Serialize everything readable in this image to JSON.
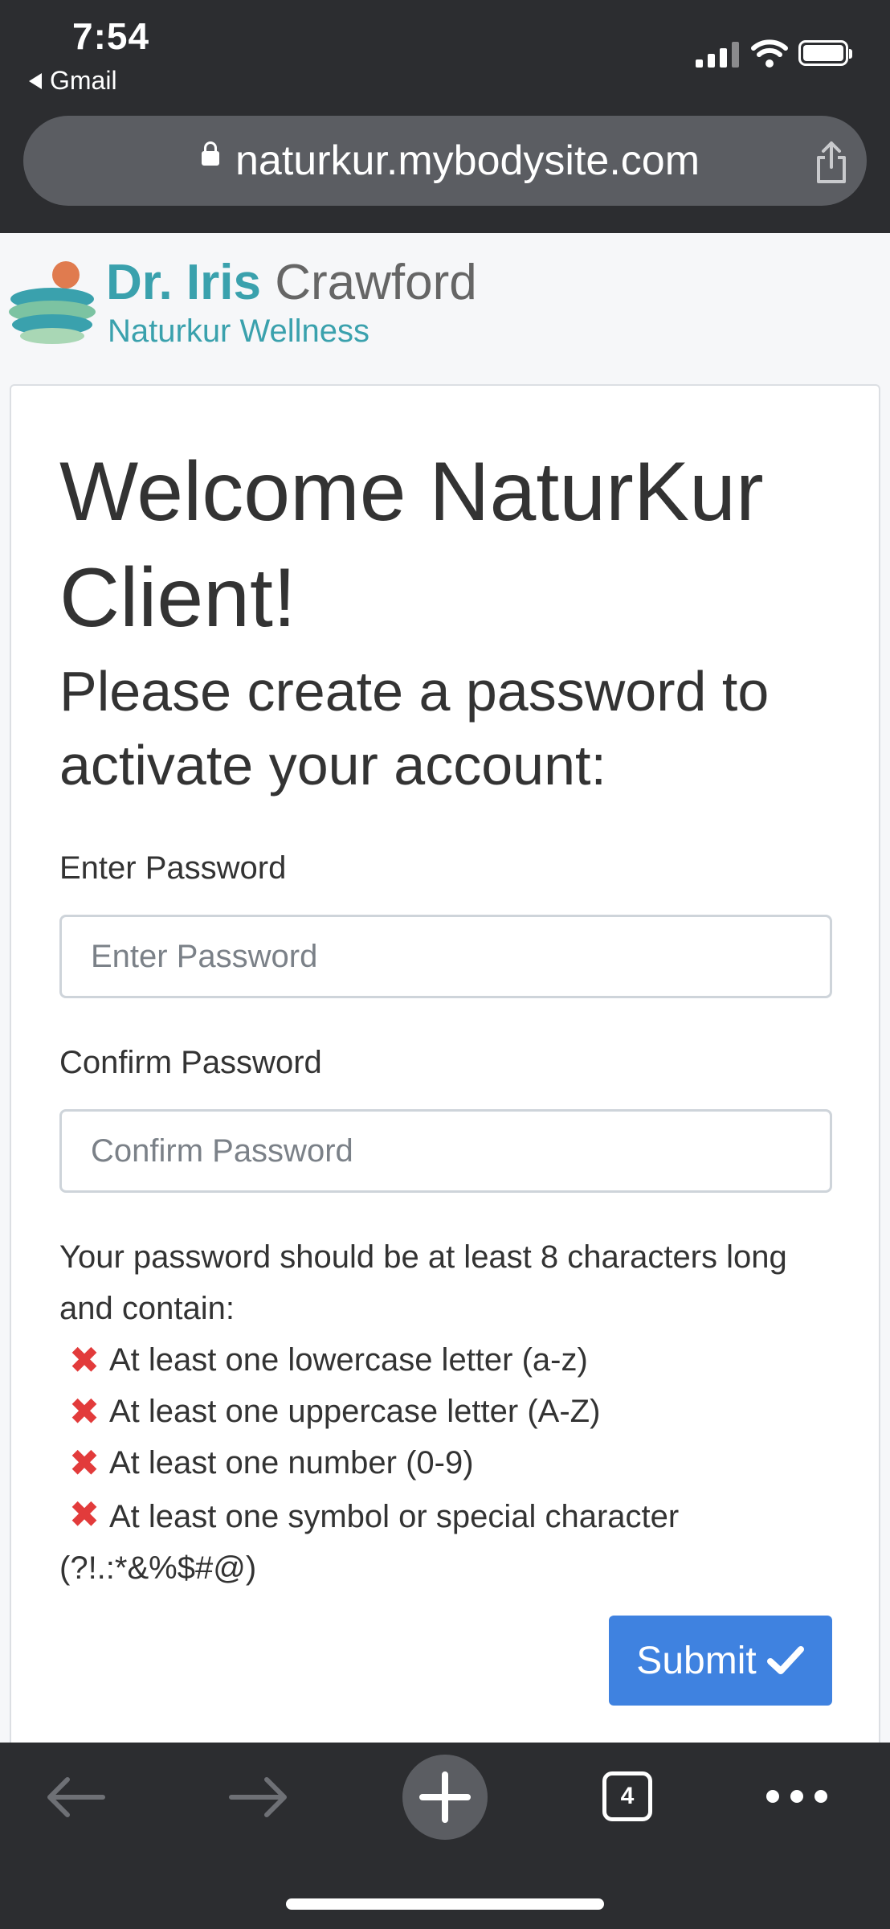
{
  "status_bar": {
    "time": "7:54",
    "back_app": "Gmail"
  },
  "browser": {
    "url": "naturkur.mybodysite.com",
    "tab_count": "4"
  },
  "logo": {
    "first": "Dr. Iris",
    "last": "Crawford",
    "subtitle": "Naturkur Wellness"
  },
  "form": {
    "title": "Welcome NaturKur Client!",
    "subtitle": "Please create a password to activate your account:",
    "password_label": "Enter Password",
    "password_placeholder": "Enter Password",
    "confirm_label": "Confirm Password",
    "confirm_placeholder": "Confirm Password",
    "requirements_intro": "Your password should be at least 8 characters long and contain:",
    "requirements": [
      "At least one lowercase letter (a-z)",
      "At least one uppercase letter (A-Z)",
      "At least one number (0-9)",
      "At least one symbol or special character (?!.:*&%$#@)"
    ],
    "requirement_status_color": "#e23b3b",
    "submit_label": "Submit"
  },
  "colors": {
    "brand": "#3aa1ad",
    "primary_button": "#3f82e0",
    "chrome": "#2c2d30"
  }
}
